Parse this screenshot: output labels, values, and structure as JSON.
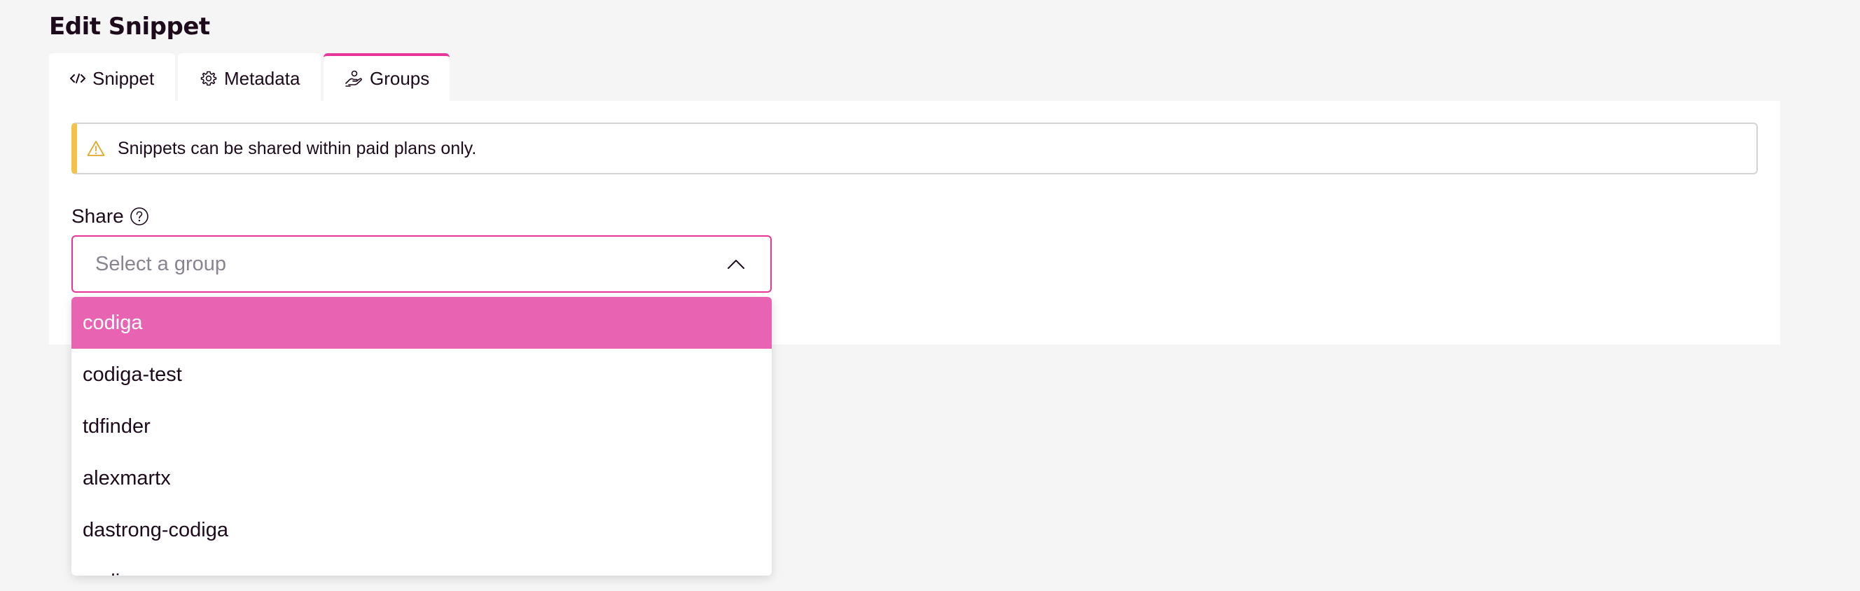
{
  "page": {
    "title": "Edit Snippet"
  },
  "tabs": [
    {
      "label": "Snippet",
      "icon": "code-icon",
      "active": false
    },
    {
      "label": "Metadata",
      "icon": "gear-icon",
      "active": false
    },
    {
      "label": "Groups",
      "icon": "share-hand-icon",
      "active": true
    }
  ],
  "alert": {
    "icon": "warning-icon",
    "text": "Snippets can be shared within paid plans only."
  },
  "share": {
    "label": "Share",
    "help_icon": "help-icon",
    "select": {
      "placeholder": "Select a group",
      "expanded": true,
      "chevron_icon": "chevron-up-icon"
    },
    "options": [
      {
        "label": "codiga",
        "highlighted": true
      },
      {
        "label": "codiga-test",
        "highlighted": false
      },
      {
        "label": "tdfinder",
        "highlighted": false
      },
      {
        "label": "alexmartx",
        "highlighted": false
      },
      {
        "label": "dastrong-codiga",
        "highlighted": false
      },
      {
        "label": "codiga-...",
        "highlighted": false
      }
    ]
  },
  "colors": {
    "accent": "#e8359a",
    "highlight": "#e864b2",
    "warning": "#f3c24b",
    "text": "#1d0b1c",
    "placeholder": "#8a8390",
    "background": "#f5f5f5"
  }
}
